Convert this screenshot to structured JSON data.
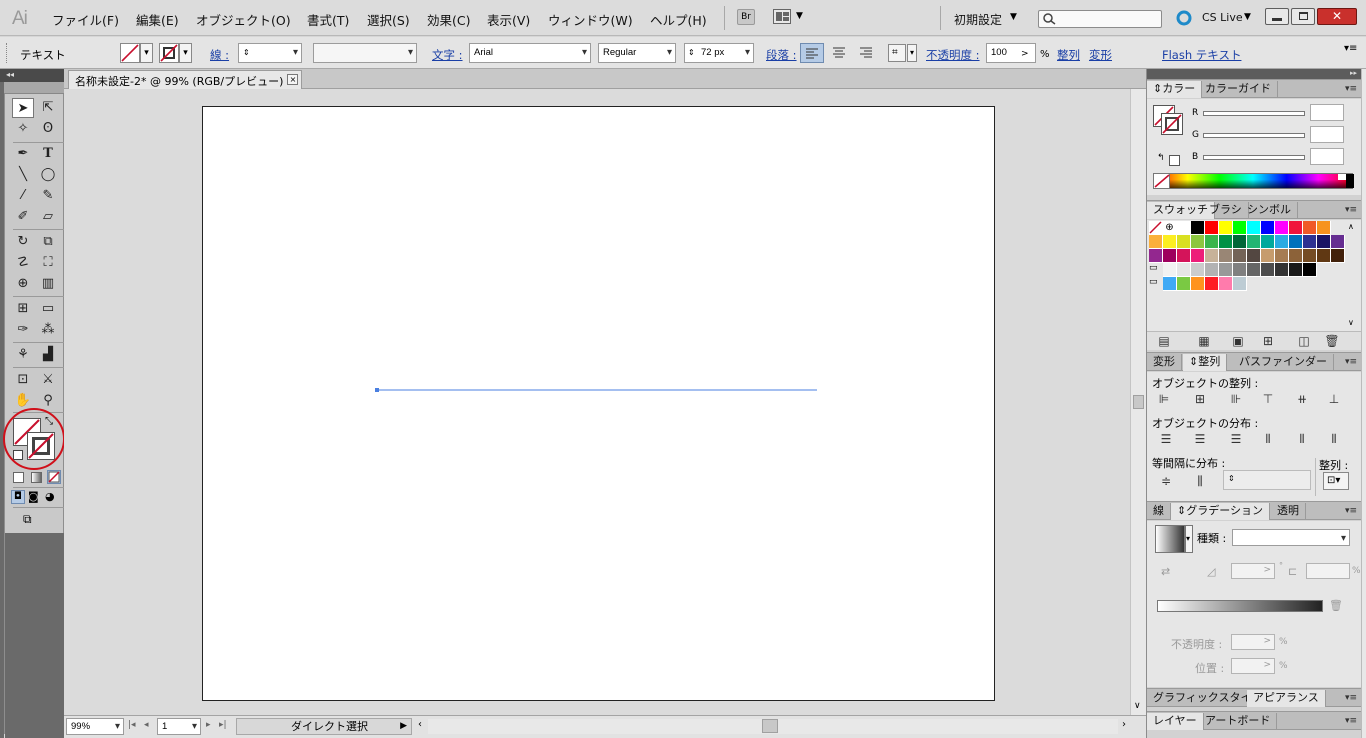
{
  "app": {
    "logo": "Ai"
  },
  "menu": [
    "ファイル(F)",
    "編集(E)",
    "オブジェクト(O)",
    "書式(T)",
    "選択(S)",
    "効果(C)",
    "表示(V)",
    "ウィンドウ(W)",
    "ヘルプ(H)"
  ],
  "bridge_label": "Br",
  "workspace": "初期設定",
  "cslive": "CS Live",
  "control": {
    "mode": "テキスト",
    "stroke_link": "線",
    "text_link": "文字",
    "font": "Arial",
    "style": "Regular",
    "size": "72 px",
    "paragraph_link": "段落",
    "opacity_link": "不透明度",
    "opacity": "100",
    "opacity_unit": "%",
    "align_link": "整列",
    "transform_link": "変形",
    "flash_link": "Flash テキスト"
  },
  "toolbar_collapse": "◂◂",
  "document": {
    "tab": "名称未設定-2* @ 99% (RGB/プレビュー)",
    "close": "×"
  },
  "status": {
    "zoom": "99%",
    "page": "1",
    "tool": "ダイレクト選択"
  },
  "panels": {
    "color": {
      "tabs": [
        "カラー",
        "カラーガイド"
      ],
      "channels": [
        "R",
        "G",
        "B"
      ]
    },
    "swatches": {
      "tabs": [
        "スウォッチ",
        "ブラシ",
        "シンボル"
      ]
    },
    "align": {
      "tabs": [
        "変形",
        "整列",
        "パスファインダー"
      ],
      "align_objects": "オブジェクトの整列 :",
      "distribute_objects": "オブジェクトの分布 :",
      "distribute_spacing": "等間隔に分布 :",
      "align_to": "整列 :"
    },
    "gradient": {
      "tabs": [
        "線",
        "グラデーション",
        "透明"
      ],
      "type_label": "種類 :",
      "opacity_label": "不透明度 :",
      "location_label": "位置 :",
      "pct": "%"
    },
    "graphic": {
      "tabs": [
        "グラフィックスタイル",
        "アピアランス"
      ]
    },
    "layers": {
      "tabs": [
        "レイヤー",
        "アートボード"
      ]
    }
  },
  "colors": {
    "accent": "#316ac5",
    "line": "#4a7fe0",
    "highlight_circle": "#d0101a",
    "swatch_rows": [
      [
        "#ffffff",
        "#000000",
        "#ff0000",
        "#ffff00",
        "#00ff00",
        "#00ffff",
        "#0000ff",
        "#ff00ff",
        "#f0143c",
        "#f05a28",
        "#f7931e"
      ],
      [
        "#fbb03b",
        "#fcee21",
        "#d9e021",
        "#8cc63f",
        "#39b54a",
        "#009245",
        "#006837",
        "#22b573",
        "#00a99d",
        "#29abe2",
        "#0071bc",
        "#2e3192",
        "#1b1464",
        "#662d91"
      ],
      [
        "#93278f",
        "#9e005d",
        "#d4145a",
        "#ed1e79",
        "#c7b299",
        "#998675",
        "#736357",
        "#534741",
        "#c69c6d",
        "#a67c52",
        "#8c6239",
        "#754c24",
        "#603813",
        "#42210b"
      ],
      [
        "#f2f2f2",
        "#e6e6e6",
        "#cccccc",
        "#b3b3b3",
        "#999999",
        "#808080",
        "#666666",
        "#4d4d4d",
        "#333333",
        "#1a1a1a",
        "#000000"
      ],
      [
        "#3fa9f5",
        "#7ac943",
        "#ff931e",
        "#ff1d25",
        "#ff7bac",
        "#bdccd4"
      ]
    ]
  }
}
